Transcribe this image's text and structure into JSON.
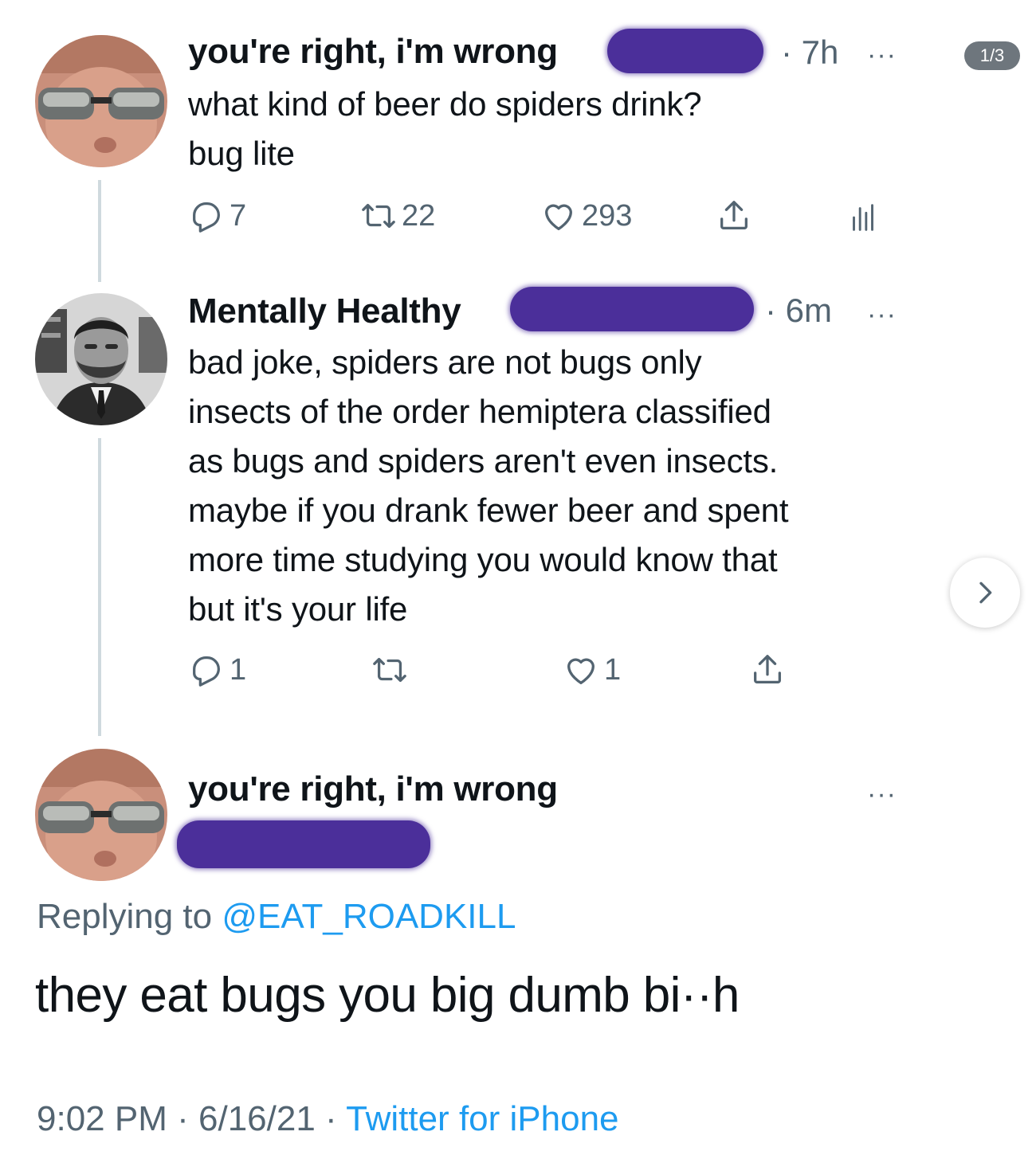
{
  "pager": "1/3",
  "tweets": [
    {
      "name": "you're right, i'm wrong",
      "time": "· 7h",
      "more": "···",
      "text_lines": [
        "what kind of beer do spiders drink?",
        "bug lite"
      ],
      "replies": "7",
      "retweets": "22",
      "likes": "293"
    },
    {
      "name": "Mentally Healthy",
      "time": "· 6m",
      "more": "···",
      "text_lines": [
        "bad joke, spiders are not bugs only",
        "insects of the order hemiptera classified",
        "as bugs and spiders aren't even insects.",
        "maybe if you drank fewer beer and spent",
        "more time studying you would know that",
        "but it's your life"
      ],
      "replies": "1",
      "retweets": "",
      "likes": "1"
    }
  ],
  "main_tweet": {
    "name": "you're right, i'm wrong",
    "more": "···",
    "replying_prefix": "Replying to",
    "replying_handle": "@EAT_ROADKILL",
    "text": "they eat bugs you big dumb bi··h",
    "time": "9:02 PM",
    "sep1": "·",
    "date": "6/16/21",
    "sep2": "·",
    "source": "Twitter for iPhone"
  },
  "colors": {
    "accent": "#1d9bf0",
    "muted": "#536471",
    "redaction": "#4b2f9a"
  },
  "icons": [
    "reply-icon",
    "retweet-icon",
    "like-icon",
    "share-icon",
    "analytics-icon",
    "chevron-right-icon"
  ]
}
